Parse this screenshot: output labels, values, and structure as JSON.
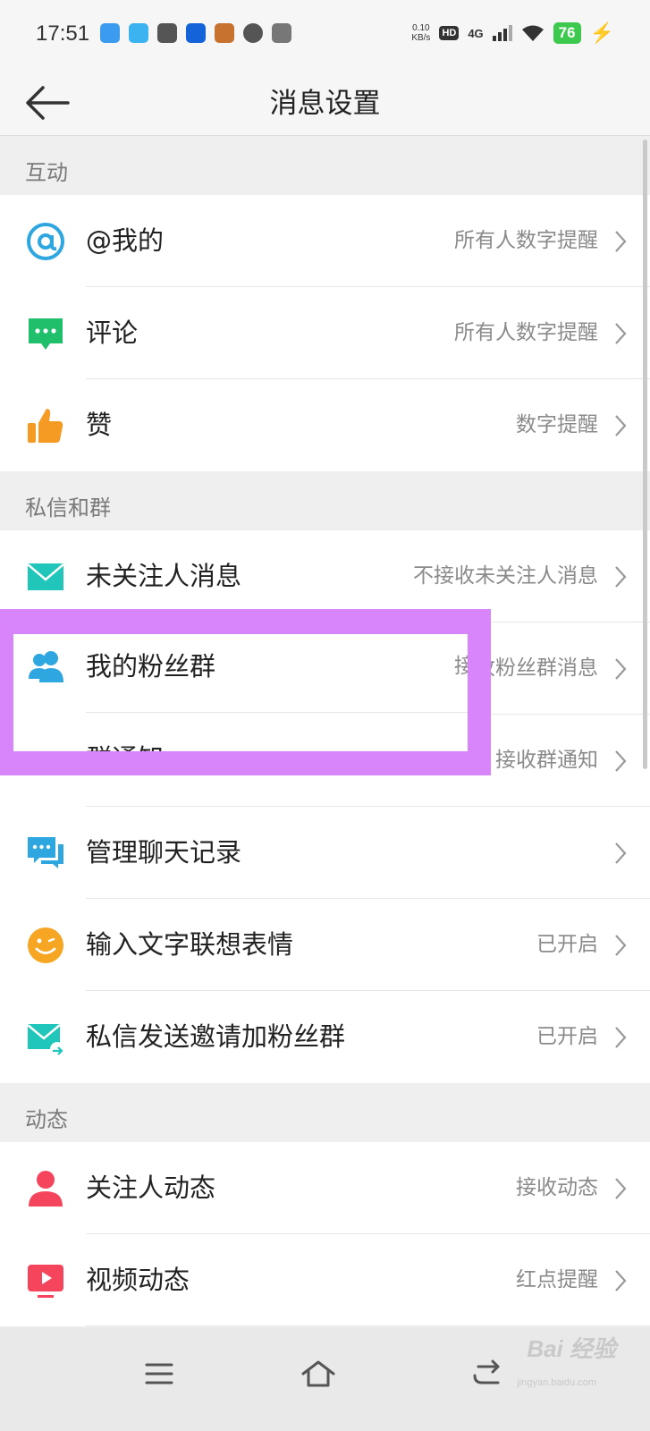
{
  "status_bar": {
    "time": "17:51",
    "net_speed_value": "0.10",
    "net_speed_unit": "KB/s",
    "hd_label": "HD",
    "network_label": "4G",
    "battery_level": "76",
    "app_icon_colors": [
      "#3a9bef",
      "#3ab3f0",
      "#555555",
      "#1463d8",
      "#c7732f",
      "#555555",
      "#777777"
    ]
  },
  "header": {
    "title": "消息设置",
    "back_icon": "arrow-left-icon"
  },
  "sections": [
    {
      "title": "互动",
      "items": [
        {
          "label": "@我的",
          "value": "所有人数字提醒",
          "icon": "at-icon",
          "color": "#2ea7e0"
        },
        {
          "label": "评论",
          "value": "所有人数字提醒",
          "icon": "comment-icon",
          "color": "#1fbf6c"
        },
        {
          "label": "赞",
          "value": "数字提醒",
          "icon": "thumbs-up-icon",
          "color": "#f59a23"
        }
      ]
    },
    {
      "title": "私信和群",
      "items": [
        {
          "label": "未关注人消息",
          "value": "不接收未关注人消息",
          "icon": "envelope-icon",
          "color": "#1fc6b9"
        },
        {
          "label": "我的粉丝群",
          "value": "接收粉丝群消息",
          "icon": "group-icon",
          "color": "#2ea7e0"
        },
        {
          "label": "群通知",
          "value": "接收群通知",
          "icon": "megaphone-icon",
          "color": "#f5455c"
        },
        {
          "label": "管理聊天记录",
          "value": "",
          "icon": "chat-bubbles-icon",
          "color": "#2ea7e0"
        },
        {
          "label": "输入文字联想表情",
          "value": "已开启",
          "icon": "smiley-icon",
          "color": "#f6a623"
        },
        {
          "label": "私信发送邀请加粉丝群",
          "value": "已开启",
          "icon": "envelope-share-icon",
          "color": "#1fc6b9"
        }
      ]
    },
    {
      "title": "动态",
      "items": [
        {
          "label": "关注人动态",
          "value": "接收动态",
          "icon": "person-icon",
          "color": "#f5455c"
        },
        {
          "label": "视频动态",
          "value": "红点提醒",
          "icon": "video-play-icon",
          "color": "#f5455c"
        }
      ]
    }
  ],
  "highlight": {
    "color": "#d885fb"
  },
  "nav_bar": {
    "menu_icon": "menu-icon",
    "home_icon": "home-icon",
    "back_icon": "back-return-icon"
  },
  "watermark": {
    "text": "Bai 经验",
    "sub": "jingyan.baidu.com"
  }
}
